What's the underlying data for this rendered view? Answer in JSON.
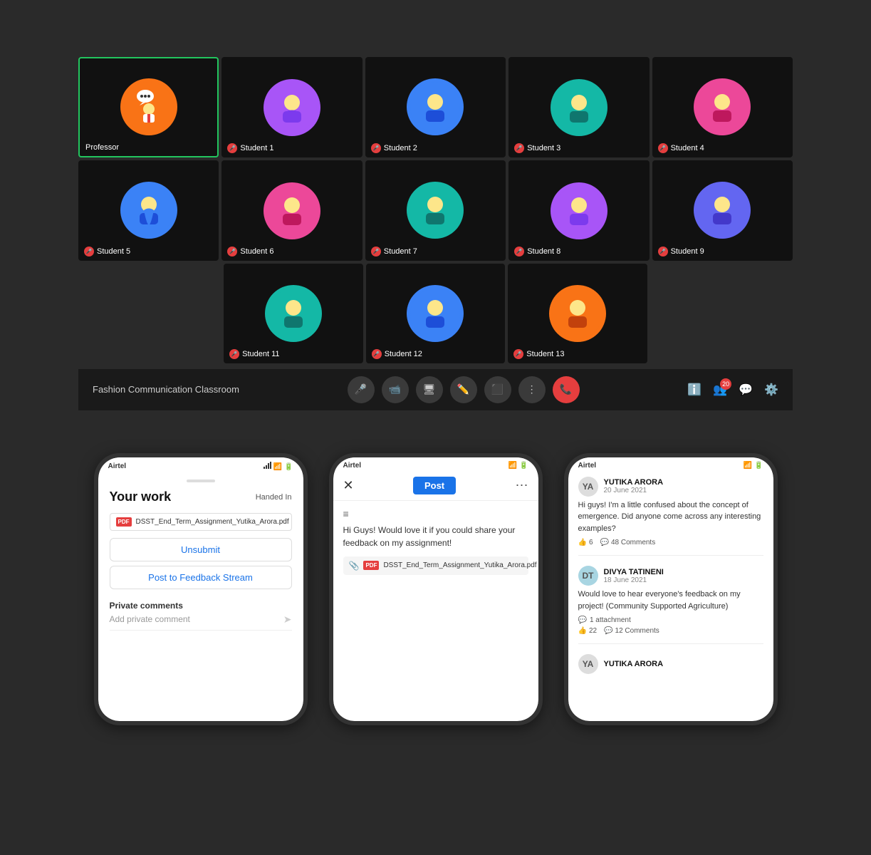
{
  "videoGrid": {
    "row1": [
      {
        "id": "professor",
        "label": "Professor",
        "muted": false,
        "color": "av-orange",
        "emoji": "👨‍🏫",
        "hasBorder": true
      },
      {
        "id": "student1",
        "label": "Student 1",
        "muted": true,
        "color": "av-purple",
        "emoji": "👩‍🎨"
      },
      {
        "id": "student2",
        "label": "Student 2",
        "muted": true,
        "color": "av-blue",
        "emoji": "👩‍💻"
      },
      {
        "id": "student3",
        "label": "Student 3",
        "muted": true,
        "color": "av-teal",
        "emoji": "🧑"
      },
      {
        "id": "student4",
        "label": "Student 4",
        "muted": true,
        "color": "av-pink",
        "emoji": "👩"
      }
    ],
    "row2": [
      {
        "id": "student5",
        "label": "Student 5",
        "muted": true,
        "color": "av-blue",
        "emoji": "🧑‍🎓"
      },
      {
        "id": "student6",
        "label": "Student 6",
        "muted": true,
        "color": "av-pink",
        "emoji": "👩‍🎤"
      },
      {
        "id": "student7",
        "label": "Student 7",
        "muted": true,
        "color": "av-teal",
        "emoji": "🧑‍💼"
      },
      {
        "id": "student8",
        "label": "Student 8",
        "muted": true,
        "color": "av-purple",
        "emoji": "👩"
      },
      {
        "id": "student9",
        "label": "Student 9",
        "muted": true,
        "color": "av-indigo",
        "emoji": "👩‍🎓"
      }
    ],
    "row3": [
      {
        "id": "student11",
        "label": "Student 11",
        "muted": true,
        "color": "av-teal",
        "emoji": "👩‍💼"
      },
      {
        "id": "student12",
        "label": "Student 12",
        "muted": true,
        "color": "av-blue",
        "emoji": "🧑‍💻"
      },
      {
        "id": "student13",
        "label": "Student 13",
        "muted": true,
        "color": "av-orange",
        "emoji": "👩‍🎤"
      }
    ]
  },
  "toolbar": {
    "roomName": "Fashion Communication Classroom",
    "participantCount": "20",
    "controls": [
      "mic",
      "video",
      "screen",
      "whiteboard",
      "layout",
      "more",
      "end"
    ]
  },
  "phone1": {
    "carrier": "Airtel",
    "title": "Your work",
    "handedInLabel": "Handed In",
    "fileName": "DSST_End_Term_Assignment_Yutika_Arora.pdf",
    "unsubmitBtn": "Unsubmit",
    "postBtn": "Post to Feedback Stream",
    "privateCommentsLabel": "Private comments",
    "addCommentPlaceholder": "Add private comment"
  },
  "phone2": {
    "carrier": "Airtel",
    "postBtnLabel": "Post",
    "composeText": "Hi Guys! Would love it if you could share your feedback on my assignment!",
    "attachedFile": "DSST_End_Term_Assignment_Yutika_Arora.pdf"
  },
  "phone3": {
    "carrier": "Airtel",
    "feedItems": [
      {
        "userName": "YUTIKA ARORA",
        "date": "20 June 2021",
        "text": "Hi guys! I'm a little confused about the concept of emergence. Did anyone come across any interesting examples?",
        "likes": "6",
        "comments": "48 Comments",
        "initials": "YA"
      },
      {
        "userName": "DIVYA TATINENI",
        "date": "18 June 2021",
        "text": "Would love to hear everyone's feedback on my project! (Community Supported Agriculture)",
        "hasAttachment": true,
        "attachmentCount": "1 attachment",
        "likes": "22",
        "comments": "12 Comments",
        "initials": "DT"
      },
      {
        "userName": "YUTIKA ARORA",
        "date": "",
        "text": "",
        "initials": "YA"
      }
    ]
  }
}
